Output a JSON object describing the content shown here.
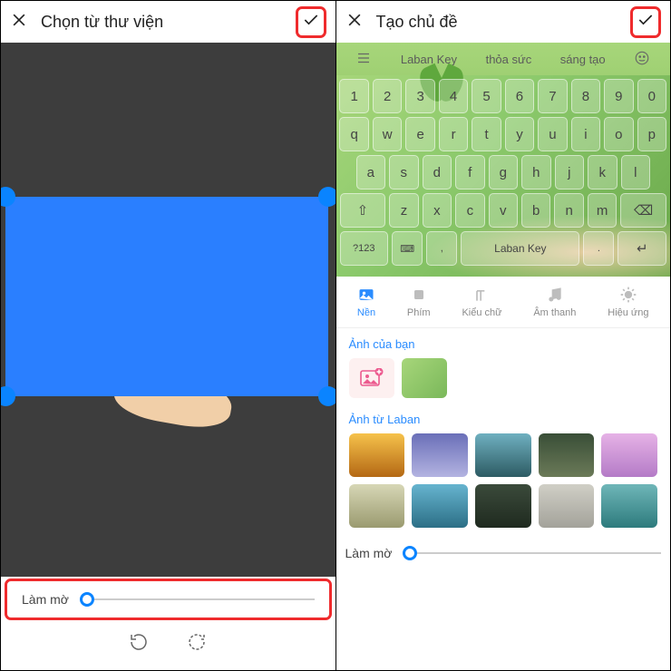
{
  "left": {
    "title": "Chọn từ thư viện",
    "slider_label": "Làm mờ"
  },
  "right": {
    "title": "Tạo chủ đề",
    "suggestions": [
      "Laban Key",
      "thỏa sức",
      "sáng tạo"
    ],
    "keyboard": {
      "row1": [
        "1",
        "2",
        "3",
        "4",
        "5",
        "6",
        "7",
        "8",
        "9",
        "0"
      ],
      "row2": [
        "q",
        "w",
        "e",
        "r",
        "t",
        "y",
        "u",
        "i",
        "o",
        "p"
      ],
      "row3": [
        "a",
        "s",
        "d",
        "f",
        "g",
        "h",
        "j",
        "k",
        "l"
      ],
      "row4_shift": "⇧",
      "row4": [
        "z",
        "x",
        "c",
        "v",
        "b",
        "n",
        "m"
      ],
      "row4_back": "⌫",
      "row5_sym": "?123",
      "row5_lang": "⌨",
      "row5_comma": ",",
      "row5_space": "Laban Key",
      "row5_period": ".",
      "row5_enter": "↵"
    },
    "tabs": [
      {
        "label": "Nền",
        "active": true
      },
      {
        "label": "Phím",
        "active": false
      },
      {
        "label": "Kiểu chữ",
        "active": false
      },
      {
        "label": "Âm thanh",
        "active": false
      },
      {
        "label": "Hiệu ứng",
        "active": false
      }
    ],
    "section_user": "Ảnh của bạn",
    "section_laban": "Ảnh từ Laban",
    "slider_label": "Làm mờ"
  }
}
